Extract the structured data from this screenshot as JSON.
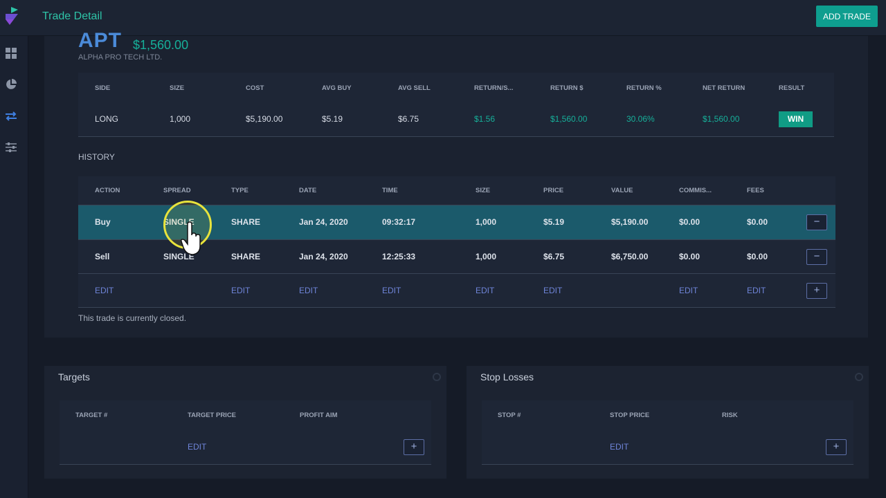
{
  "app": {
    "title": "Trade Detail",
    "add_trade_label": "ADD TRADE"
  },
  "sidebar": {
    "icons": [
      "dashboard-icon",
      "pie-chart-icon",
      "transfer-icon",
      "sliders-icon"
    ],
    "active": "transfer-icon"
  },
  "trade": {
    "ticker": "APT",
    "amount": "$1,560.00",
    "company": "ALPHA PRO TECH LTD.",
    "summary_headers": [
      "SIDE",
      "SIZE",
      "COST",
      "AVG BUY",
      "AVG SELL",
      "RETURN/S...",
      "RETURN $",
      "RETURN %",
      "NET RETURN",
      "RESULT"
    ],
    "summary_values": [
      "LONG",
      "1,000",
      "$5,190.00",
      "$5.19",
      "$6.75",
      "$1.56",
      "$1,560.00",
      "30.06%",
      "$1,560.00"
    ],
    "result": "WIN",
    "colors": {
      "accent": "#16b09a",
      "ticker": "#4b8bd9",
      "edit_link": "#6f84d8"
    }
  },
  "history": {
    "label": "HISTORY",
    "headers": [
      "ACTION",
      "SPREAD",
      "TYPE",
      "DATE",
      "TIME",
      "SIZE",
      "PRICE",
      "VALUE",
      "COMMIS...",
      "FEES"
    ],
    "rows": [
      [
        "Buy",
        "SINGLE",
        "SHARE",
        "Jan 24, 2020",
        "09:32:17",
        "1,000",
        "$5.19",
        "$5,190.00",
        "$0.00",
        "$0.00"
      ],
      [
        "Sell",
        "SINGLE",
        "SHARE",
        "Jan 24, 2020",
        "12:25:33",
        "1,000",
        "$6.75",
        "$6,750.00",
        "$0.00",
        "$0.00"
      ]
    ],
    "edit_label": "EDIT",
    "remove_glyph": "−",
    "add_glyph": "+",
    "closed_note": "This trade is currently closed."
  },
  "targets": {
    "title": "Targets",
    "headers": [
      "TARGET #",
      "TARGET PRICE",
      "PROFIT AIM"
    ],
    "edit_label": "EDIT",
    "add_glyph": "+"
  },
  "stop_losses": {
    "title": "Stop Losses",
    "headers": [
      "STOP #",
      "STOP PRICE",
      "RISK"
    ],
    "edit_label": "EDIT",
    "add_glyph": "+"
  }
}
